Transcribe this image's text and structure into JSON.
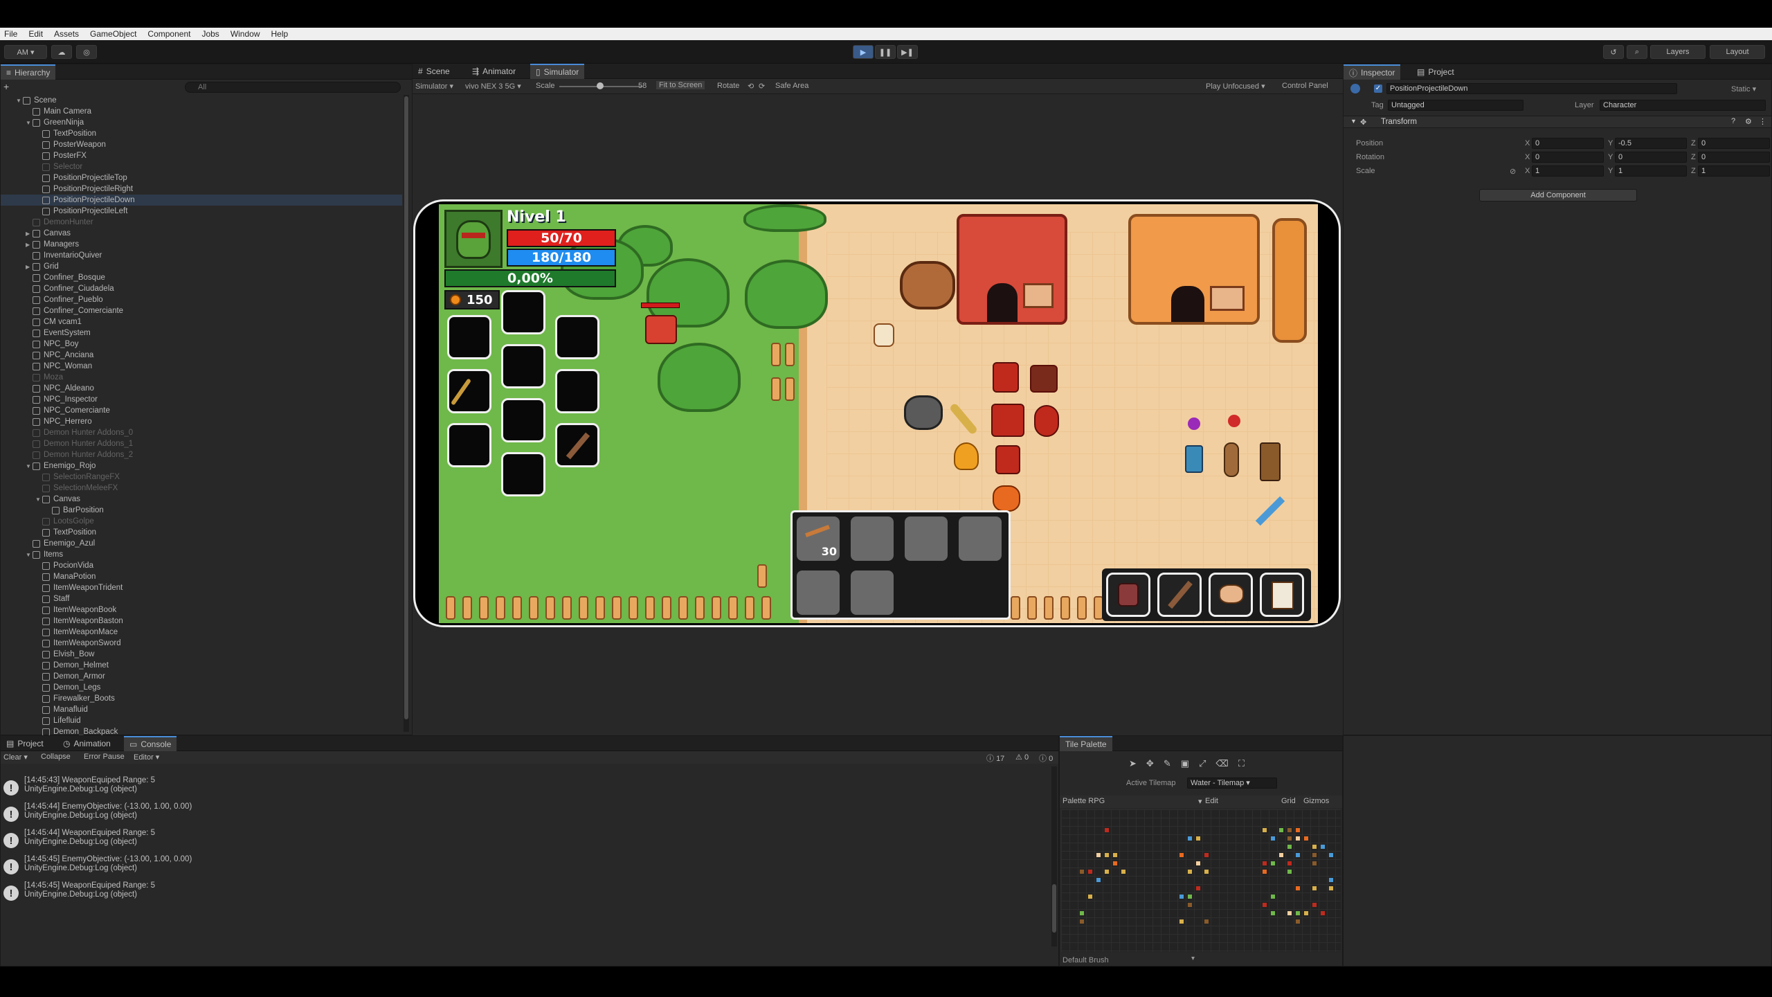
{
  "menu": [
    "File",
    "Edit",
    "Assets",
    "GameObject",
    "Component",
    "Jobs",
    "Window",
    "Help"
  ],
  "toolbar": {
    "account": "AM ▾",
    "layers": "Layers",
    "layout": "Layout"
  },
  "hierarchy": {
    "title": "Hierarchy",
    "search_placeholder": "All",
    "rows": [
      {
        "label": "Scene",
        "depth": 0,
        "dim": false,
        "sel": false
      },
      {
        "label": "Main Camera",
        "depth": 1,
        "dim": false,
        "sel": false
      },
      {
        "label": "GreenNinja",
        "depth": 1,
        "dim": false,
        "sel": false
      },
      {
        "label": "TextPosition",
        "depth": 2,
        "dim": false,
        "sel": false
      },
      {
        "label": "PosterWeapon",
        "depth": 2,
        "dim": false,
        "sel": false
      },
      {
        "label": "PosterFX",
        "depth": 2,
        "dim": false,
        "sel": false
      },
      {
        "label": "Selector",
        "depth": 2,
        "dim": true,
        "sel": false
      },
      {
        "label": "PositionProjectileTop",
        "depth": 2,
        "dim": false,
        "sel": false
      },
      {
        "label": "PositionProjectileRight",
        "depth": 2,
        "dim": false,
        "sel": false
      },
      {
        "label": "PositionProjectileDown",
        "depth": 2,
        "dim": false,
        "sel": true
      },
      {
        "label": "PositionProjectileLeft",
        "depth": 2,
        "dim": false,
        "sel": false
      },
      {
        "label": "DemonHunter",
        "depth": 1,
        "dim": true,
        "sel": false
      },
      {
        "label": "Canvas",
        "depth": 1,
        "dim": false,
        "sel": false
      },
      {
        "label": "Managers",
        "depth": 1,
        "dim": false,
        "sel": false
      },
      {
        "label": "InventarioQuiver",
        "depth": 1,
        "dim": false,
        "sel": false
      },
      {
        "label": "Grid",
        "depth": 1,
        "dim": false,
        "sel": false
      },
      {
        "label": "Confiner_Bosque",
        "depth": 1,
        "dim": false,
        "sel": false
      },
      {
        "label": "Confiner_Ciudadela",
        "depth": 1,
        "dim": false,
        "sel": false
      },
      {
        "label": "Confiner_Pueblo",
        "depth": 1,
        "dim": false,
        "sel": false
      },
      {
        "label": "Confiner_Comerciante",
        "depth": 1,
        "dim": false,
        "sel": false
      },
      {
        "label": "CM vcam1",
        "depth": 1,
        "dim": false,
        "sel": false
      },
      {
        "label": "EventSystem",
        "depth": 1,
        "dim": false,
        "sel": false
      },
      {
        "label": "NPC_Boy",
        "depth": 1,
        "dim": false,
        "sel": false
      },
      {
        "label": "NPC_Anciana",
        "depth": 1,
        "dim": false,
        "sel": false
      },
      {
        "label": "NPC_Woman",
        "depth": 1,
        "dim": false,
        "sel": false
      },
      {
        "label": "Moza",
        "depth": 1,
        "dim": true,
        "sel": false
      },
      {
        "label": "NPC_Aldeano",
        "depth": 1,
        "dim": false,
        "sel": false
      },
      {
        "label": "NPC_Inspector",
        "depth": 1,
        "dim": false,
        "sel": false
      },
      {
        "label": "NPC_Comerciante",
        "depth": 1,
        "dim": false,
        "sel": false
      },
      {
        "label": "NPC_Herrero",
        "depth": 1,
        "dim": false,
        "sel": false
      },
      {
        "label": "Demon Hunter Addons_0",
        "depth": 1,
        "dim": true,
        "sel": false
      },
      {
        "label": "Demon Hunter Addons_1",
        "depth": 1,
        "dim": true,
        "sel": false
      },
      {
        "label": "Demon Hunter Addons_2",
        "depth": 1,
        "dim": true,
        "sel": false
      },
      {
        "label": "Enemigo_Rojo",
        "depth": 1,
        "dim": false,
        "sel": false
      },
      {
        "label": "SelectionRangeFX",
        "depth": 2,
        "dim": true,
        "sel": false
      },
      {
        "label": "SelectionMeleeFX",
        "depth": 2,
        "dim": true,
        "sel": false
      },
      {
        "label": "Canvas",
        "depth": 2,
        "dim": false,
        "sel": false
      },
      {
        "label": "BarPosition",
        "depth": 3,
        "dim": false,
        "sel": false
      },
      {
        "label": "LootsGolpe",
        "depth": 2,
        "dim": true,
        "sel": false
      },
      {
        "label": "TextPosition",
        "depth": 2,
        "dim": false,
        "sel": false
      },
      {
        "label": "Enemigo_Azul",
        "depth": 1,
        "dim": false,
        "sel": false
      },
      {
        "label": "Items",
        "depth": 1,
        "dim": false,
        "sel": false
      },
      {
        "label": "PocionVida",
        "depth": 2,
        "dim": false,
        "sel": false
      },
      {
        "label": "ManaPotion",
        "depth": 2,
        "dim": false,
        "sel": false
      },
      {
        "label": "ItemWeaponTrident",
        "depth": 2,
        "dim": false,
        "sel": false
      },
      {
        "label": "Staff",
        "depth": 2,
        "dim": false,
        "sel": false
      },
      {
        "label": "ItemWeaponBook",
        "depth": 2,
        "dim": false,
        "sel": false
      },
      {
        "label": "ItemWeaponBaston",
        "depth": 2,
        "dim": false,
        "sel": false
      },
      {
        "label": "ItemWeaponMace",
        "depth": 2,
        "dim": false,
        "sel": false
      },
      {
        "label": "ItemWeaponSword",
        "depth": 2,
        "dim": false,
        "sel": false
      },
      {
        "label": "Elvish_Bow",
        "depth": 2,
        "dim": false,
        "sel": false
      },
      {
        "label": "Demon_Helmet",
        "depth": 2,
        "dim": false,
        "sel": false
      },
      {
        "label": "Demon_Armor",
        "depth": 2,
        "dim": false,
        "sel": false
      },
      {
        "label": "Demon_Legs",
        "depth": 2,
        "dim": false,
        "sel": false
      },
      {
        "label": "Firewalker_Boots",
        "depth": 2,
        "dim": false,
        "sel": false
      },
      {
        "label": "Manafluid",
        "depth": 2,
        "dim": false,
        "sel": false
      },
      {
        "label": "Lifefluid",
        "depth": 2,
        "dim": false,
        "sel": false
      },
      {
        "label": "Demon_Backpack",
        "depth": 2,
        "dim": false,
        "sel": false
      }
    ]
  },
  "scene_tabs": [
    "Scene",
    "Animator",
    "Simulator"
  ],
  "simbar": {
    "mode": "Simulator ▾",
    "device": "vivo NEX 3 5G ▾",
    "scale_label": "Scale",
    "scale_value": "58",
    "fit": "Fit to Screen",
    "rotate": "Rotate",
    "safe_area": "Safe Area",
    "play_mode": "Play Unfocused ▾",
    "control_panel": "Control Panel"
  },
  "game": {
    "level": "Nivel 1",
    "hp": "50/70",
    "mp": "180/180",
    "xp": "0,00%",
    "coins": "150",
    "quiver_count": "30"
  },
  "inspector": {
    "tabs": [
      "Inspector",
      "Project"
    ],
    "object_name": "PositionProjectileDown",
    "static": "Static ▾",
    "tag_label": "Tag",
    "tag_value": "Untagged",
    "layer_label": "Layer",
    "layer_value": "Character",
    "component": "Transform",
    "rows": [
      {
        "label": "Position",
        "x": "0",
        "y": "-0.5",
        "z": "0"
      },
      {
        "label": "Rotation",
        "x": "0",
        "y": "0",
        "z": "0"
      },
      {
        "label": "Scale",
        "x": "1",
        "y": "1",
        "z": "1"
      }
    ],
    "axis": {
      "x": "X",
      "y": "Y",
      "z": "Z"
    },
    "add_component": "Add Component"
  },
  "console": {
    "tabs": [
      "Project",
      "Animation",
      "Console"
    ],
    "toolbar": [
      "Clear ▾",
      "Collapse",
      "Error Pause",
      "Editor ▾"
    ],
    "counts": {
      "info": "17",
      "warn": "0",
      "error": "0"
    },
    "logs": [
      {
        "msg": "[14:45:43] WeaponEquiped Range: 5",
        "sub": "UnityEngine.Debug:Log (object)"
      },
      {
        "msg": "[14:45:44] EnemyObjective: (-13.00, 1.00, 0.00)",
        "sub": "UnityEngine.Debug:Log (object)"
      },
      {
        "msg": "[14:45:44] WeaponEquiped Range: 5",
        "sub": "UnityEngine.Debug:Log (object)"
      },
      {
        "msg": "[14:45:45] EnemyObjective: (-13.00, 1.00, 0.00)",
        "sub": "UnityEngine.Debug:Log (object)"
      },
      {
        "msg": "[14:45:45] WeaponEquiped Range: 5",
        "sub": "UnityEngine.Debug:Log (object)"
      }
    ]
  },
  "tile_palette": {
    "title": "Tile Palette",
    "active_tilemap_label": "Active Tilemap",
    "active_tilemap": "Water - Tilemap ▾",
    "palette": "Palette RPG",
    "edit": "Edit",
    "grid": "Grid",
    "gizmos": "Gizmos",
    "brush": "Default Brush"
  },
  "colors": {
    "accent": "#4a8cd8",
    "hp": "#e0201c",
    "mp": "#1e8cf0",
    "xp": "#1f7a2c",
    "panel": "#282828",
    "game_grass": "#6fb84a",
    "game_floor": "#f2cfa0"
  }
}
